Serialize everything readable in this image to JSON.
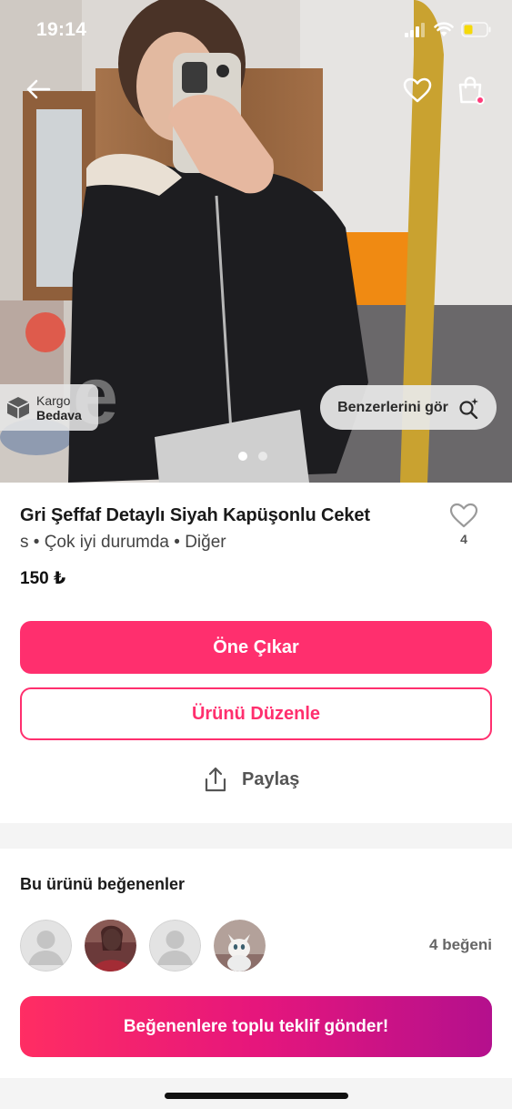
{
  "status_bar": {
    "time": "19:14",
    "battery_color": "#f5d90a"
  },
  "nav": {
    "back_icon": "back-arrow-icon",
    "favorite_icon": "heart-outline-icon",
    "cart_icon": "shopping-bag-icon"
  },
  "photo": {
    "cargo_badge": {
      "line1": "Kargo",
      "line2": "Bedava"
    },
    "similar_button": "Benzerlerini gör",
    "carousel": {
      "current": 1,
      "total": 2
    }
  },
  "product": {
    "title": "Gri Şeffaf Detaylı Siyah Kapüşonlu Ceket",
    "meta": "s • Çok iyi durumda • Diğer",
    "price": "150 ₺",
    "likes": "4"
  },
  "actions": {
    "promote": "Öne Çıkar",
    "edit": "Ürünü Düzenle",
    "share": "Paylaş"
  },
  "likers": {
    "title": "Bu ürünü beğenenler",
    "count_label": "4 beğeni",
    "avatars": [
      "default-avatar",
      "user-photo",
      "default-avatar",
      "cat-photo"
    ],
    "bulk_offer_button": "Beğenenlere toplu teklif gönder!"
  },
  "colors": {
    "accent": "#ff2f6e",
    "gradient_start": "#ff2d63",
    "gradient_end": "#b4108d"
  }
}
